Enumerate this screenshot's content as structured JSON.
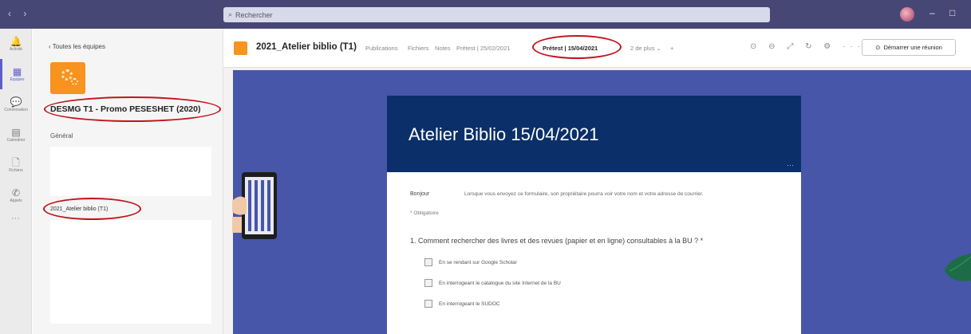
{
  "window": {
    "search_placeholder": "Rechercher",
    "nav_arrows": "‹ ›",
    "controls": [
      "–",
      "□"
    ]
  },
  "rail": {
    "items": [
      {
        "icon": "bell-icon",
        "glyph": "🔔",
        "label": "Activité"
      },
      {
        "icon": "teams-icon",
        "glyph": "▦",
        "label": "Équipes"
      },
      {
        "icon": "chat-icon",
        "glyph": "💬",
        "label": "Conversation"
      },
      {
        "icon": "calendar-icon",
        "glyph": "▤",
        "label": "Calendrier"
      },
      {
        "icon": "file-icon",
        "glyph": "🗋",
        "label": "Fichiers"
      },
      {
        "icon": "phone-icon",
        "glyph": "✆",
        "label": "Appels"
      }
    ],
    "more": "···"
  },
  "teams_panel": {
    "back_label": "‹  Toutes les équipes",
    "team_name": "DESMG T1 - Promo PESESHET (2020)",
    "general_label": "Général",
    "channel_label": "2021_Atelier biblio (T1)"
  },
  "channel": {
    "title": "2021_Atelier biblio (T1)",
    "tabs": [
      "Publications",
      "Fichiers",
      "Notes",
      "Prétest | 25/02/2021",
      "Prétest | 15/04/2021",
      "2 de plus ⌄",
      "+"
    ],
    "active_tab": "Prétest | 15/04/2021",
    "header_icons": "⊙ ⊖ ⤢ ↻ ⚙ ···",
    "meet_button": "Démarrer une réunion"
  },
  "form": {
    "title": "Atelier Biblio 15/04/2021",
    "dots": "···",
    "hello": "Bonjour",
    "hello_note": "Lorsque vous envoyez ce formulaire, son propriétaire pourra voir votre nom et votre adresse de courrier.",
    "required_note": "* Obligatoire",
    "question": "1. Comment rechercher des livres et des revues (papier et en ligne) consultables à la BU ? *",
    "options": [
      "En se rendant sur Google Scholar",
      "En interrogeant le catalogue du site Internet de la BU",
      "En interrogeant le SUDOC"
    ]
  },
  "colors": {
    "titlebar": "#464775",
    "accent": "#5b5fc7",
    "team_orange": "#f7931e",
    "form_background": "#4756a8",
    "form_header": "#0b2f69",
    "annotation_red": "#c0141c"
  }
}
